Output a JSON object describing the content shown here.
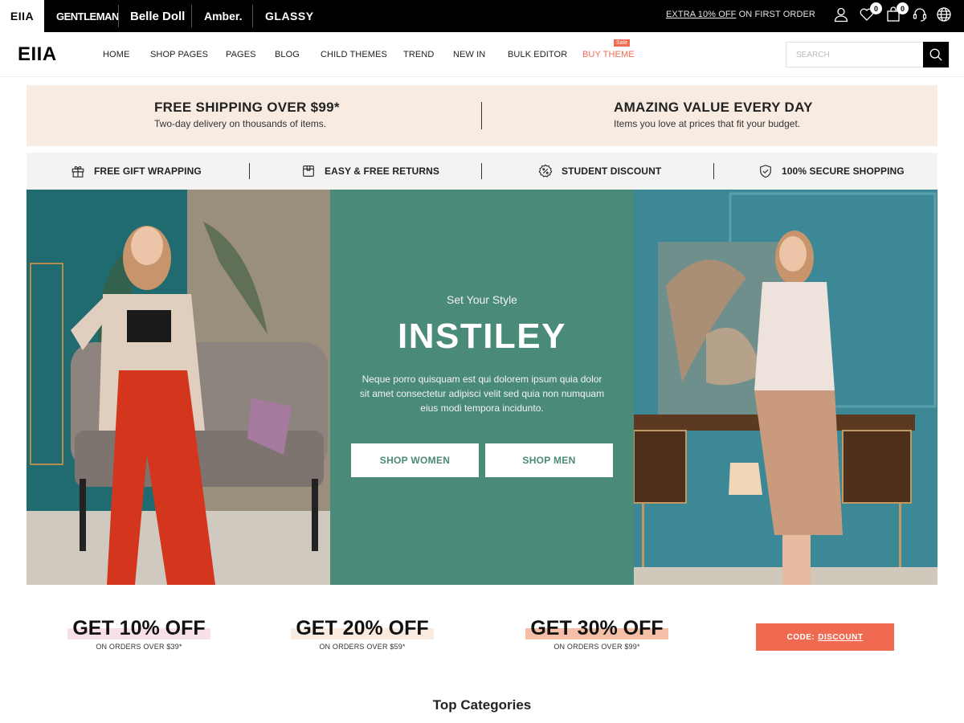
{
  "topbar": {
    "brands": [
      {
        "label": "EIIA",
        "active": true
      },
      {
        "label": "GENTLEMAN"
      },
      {
        "label": "Belle Doll"
      },
      {
        "label": "Amber."
      },
      {
        "label": "GLASSY"
      }
    ],
    "promo_link": "EXTRA 10% OFF",
    "promo_rest": " ON FIRST ORDER",
    "icons": [
      "account-icon",
      "wishlist-icon",
      "cart-icon",
      "support-icon",
      "language-icon"
    ],
    "wishlist_count": "0",
    "cart_count": "0"
  },
  "header": {
    "logo": "EIIA",
    "nav": [
      "HOME",
      "SHOP PAGES",
      "PAGES",
      "BLOG",
      "CHILD THEMES",
      "TREND",
      "NEW IN",
      "BULK EDITOR",
      "BUY THEME"
    ],
    "sale_badge": "Sale",
    "search_placeholder": "SEARCH"
  },
  "promo_banner": {
    "items": [
      {
        "title": "FREE SHIPPING OVER $99*",
        "subtitle": "Two-day delivery on thousands of items."
      },
      {
        "title": "AMAZING VALUE EVERY DAY",
        "subtitle": "Items you love at prices that fit your budget."
      }
    ]
  },
  "features": [
    {
      "icon": "gift-icon",
      "label": "FREE GIFT WRAPPING"
    },
    {
      "icon": "box-icon",
      "label": "EASY & FREE RETURNS"
    },
    {
      "icon": "discount-badge-icon",
      "label": "STUDENT DISCOUNT"
    },
    {
      "icon": "shield-check-icon",
      "label": "100% SECURE SHOPPING"
    }
  ],
  "hero": {
    "subtitle": "Set Your Style",
    "title": "INSTILEY",
    "description": "Neque porro quisquam est qui dolorem ipsum quia dolor sit amet consectetur adipisci velit sed quia non numquam eius modi tempora incidunto.",
    "buttons": [
      "SHOP WOMEN",
      "SHOP MEN"
    ],
    "accent_color": "#4a8a78"
  },
  "discounts": [
    {
      "title": "GET 10% OFF",
      "subtitle": "ON ORDERS OVER $39*",
      "highlight": "#f7e0e8"
    },
    {
      "title": "GET 20% OFF",
      "subtitle": "ON ORDERS OVER $59*",
      "highlight": "#f9ebe0"
    },
    {
      "title": "GET 30% OFF",
      "subtitle": "ON ORDERS OVER $99*",
      "highlight": "#f4bfa6"
    }
  ],
  "code_button": {
    "prefix": "CODE:",
    "code": "DISCOUNT",
    "color": "#ef6a51"
  },
  "section_title": "Top Categories"
}
